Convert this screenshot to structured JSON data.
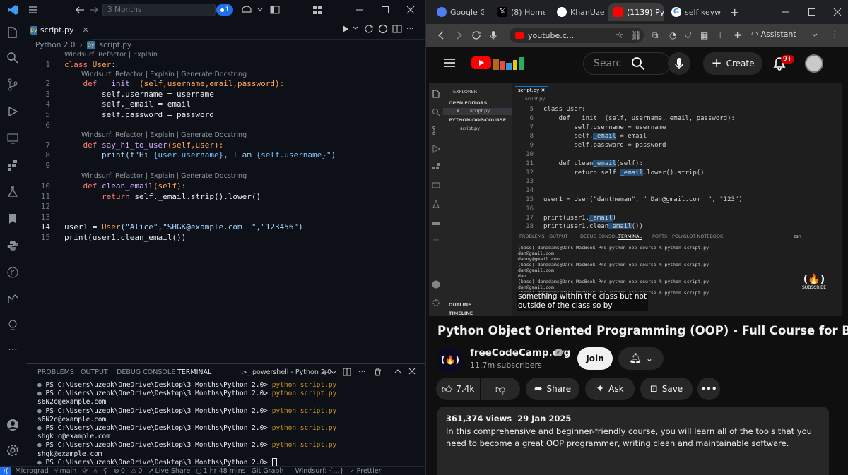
{
  "vscode": {
    "command_center": "3 Months",
    "notification_count": "1",
    "tab_label": "script.py",
    "breadcrumb": [
      "Python 2.0",
      "script.py"
    ],
    "code_lens_top": "Windsurf: Refactor | Explain",
    "code_lens": "Windsurf: Refactor | Explain | Generate Docstring",
    "code": {
      "l1_kw": "class",
      "l1_name": "User",
      "l2_kw": "def",
      "l2_fn": "__init__",
      "l2_params": "(self,username,email,password):",
      "l3": "self.username = username",
      "l4": "self._email = email",
      "l5": "self.password = password",
      "l7_kw": "def",
      "l7_fn": "say_hi_to_user",
      "l7_params": "(self,user):",
      "l8_pre": "print(f\"Hi ",
      "l8_i1": "{user.username}",
      "l8_mid": ", I am ",
      "l8_i2": "{self.username}",
      "l8_post": "\")",
      "l10_kw": "def",
      "l10_fn": "clean_email",
      "l10_params": "(self):",
      "l11_kw": "return",
      "l11_rest": "self._email.strip().lower()",
      "l14_pre": "user1 = ",
      "l14_cls": "User",
      "l14_args": "(\"Alice\",\"SHGK@example.com  \",\"123456\")",
      "l15": "print(user1.clean_email())"
    },
    "panel_tabs": [
      "PROBLEMS",
      "OUTPUT",
      "DEBUG CONSOLE",
      "TERMINAL"
    ],
    "terminal_name": "powershell - Python 2.0",
    "terminal_lines": [
      {
        "prompt": "PS C:\\Users\\uzebk\\OneDrive\\Desktop\\3 Months\\Python 2.0> ",
        "cmd": "python script.py",
        "out": ""
      },
      {
        "prompt": "PS C:\\Users\\uzebk\\OneDrive\\Desktop\\3 Months\\Python 2.0> ",
        "cmd": "python script.py",
        "out": "s6N2c@example.com"
      },
      {
        "prompt": "PS C:\\Users\\uzebk\\OneDrive\\Desktop\\3 Months\\Python 2.0> ",
        "cmd": "python script.py",
        "out": "s6N2c@example.com"
      },
      {
        "prompt": "PS C:\\Users\\uzebk\\OneDrive\\Desktop\\3 Months\\Python 2.0> ",
        "cmd": "python script.py",
        "out": "shgk c@example.com"
      },
      {
        "prompt": "PS C:\\Users\\uzebk\\OneDrive\\Desktop\\3 Months\\Python 2.0> ",
        "cmd": "python script.py",
        "out": "shgk@example.com"
      },
      {
        "prompt": "PS C:\\Users\\uzebk\\OneDrive\\Desktop\\3 Months\\Python 2.0> ",
        "cmd": "",
        "out": ""
      }
    ],
    "status": {
      "project": "Micrograd",
      "branch": "main",
      "problems": "0",
      "warnings": "0",
      "liveshare": "Live Share",
      "time": "1 hr 48 mins",
      "gitgraph": "Git Graph",
      "windsurf": "Windsurf: {...}",
      "prettier": "Prettier"
    }
  },
  "chrome": {
    "tabs": [
      "Google G",
      "(8) Home",
      "KhanUzer",
      "(1139) Pyt",
      "self keyw"
    ],
    "url": "youtube.c...",
    "assistant": "Assistant"
  },
  "youtube": {
    "search_placeholder": "Searc",
    "create_label": "Create",
    "notif_badge": "9+",
    "video_title": "Python Object Oriented Programming (OOP) - Full Course for Beginners",
    "channel_name": "freeCodeCamp.org",
    "subscribers": "11.7m subscribers",
    "join_label": "Join",
    "likes": "7.4k",
    "share_label": "Share",
    "ask_label": "Ask",
    "save_label": "Save",
    "views": "361,374 views",
    "date": "29 Jan 2025",
    "description": "In this comprehensive and beginner-friendly course, you will learn all of the tools that you need to become a great OOP programmer, writing clean and maintainable software.",
    "caption_lines": [
      "something within the class but not",
      "outside of the class so by"
    ],
    "watermark": "SUBSCRIBE",
    "embedded": {
      "explorer_title": "EXPLORER",
      "open_editors": "OPEN EDITORS",
      "folder": "PYTHON-OOP-COURSE",
      "file": "script.py",
      "outline": "OUTLINE",
      "timeline": "TIMELINE",
      "code_lines": [
        {
          "n": "5",
          "t": "class User:"
        },
        {
          "n": "6",
          "t": "    def __init__(self, username, email, password):"
        },
        {
          "n": "7",
          "t": "        self.username = username"
        },
        {
          "n": "8",
          "t": "        self._email = email"
        },
        {
          "n": "9",
          "t": "        self.password = password"
        },
        {
          "n": "10",
          "t": ""
        },
        {
          "n": "11",
          "t": "    def clean_email(self):"
        },
        {
          "n": "12",
          "t": "        return self._email.lower().strip()"
        },
        {
          "n": "13",
          "t": ""
        },
        {
          "n": "14",
          "t": ""
        },
        {
          "n": "15",
          "t": "user1 = User(\"dantheman\", \" Dan@gmail.com  \", \"123\")"
        },
        {
          "n": "16",
          "t": ""
        },
        {
          "n": "17",
          "t": "print(user1._email)"
        },
        {
          "n": "18",
          "t": "print(user1.clean_email())"
        }
      ],
      "panel_tabs": [
        "PROBLEMS",
        "OUTPUT",
        "DEBUG CONSOLE",
        "TERMINAL",
        "PORTS",
        "POLYGLOT NOTEBOOK"
      ],
      "shell": "zsh",
      "terminal": "(base) danadams@Dans-MacBook-Pro python-oop-course % python script.py\ndan@gmail.com\ndanny@gmail.com\n(base) danadams@Dans-MacBook-Pro python-oop-course % python script.py\ndan@gmail.com\ndan\n(base) danadams@Dans-MacBook-Pro python-oop-course % python script.py\ndan@gmail.com\n(base) danadams@Dans-MacBook-Pro python-oop-course % python script.py"
    }
  }
}
